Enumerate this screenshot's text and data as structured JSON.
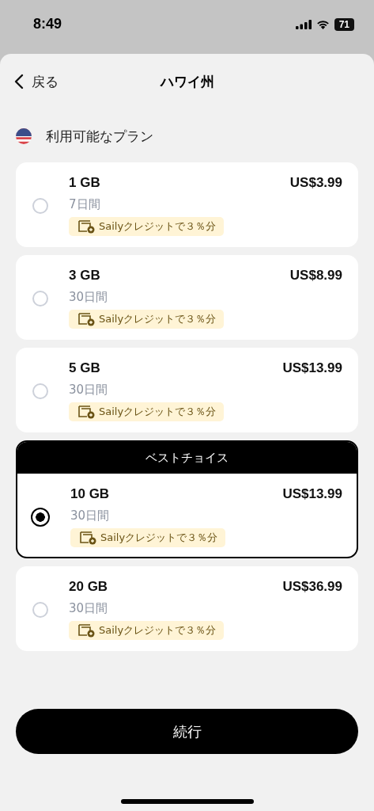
{
  "status_bar": {
    "time": "8:49",
    "battery": "71"
  },
  "header": {
    "back": "戻る",
    "title": "ハワイ州"
  },
  "section": {
    "title": "利用可能なプラン"
  },
  "plans": [
    {
      "size": "1 GB",
      "duration": "7日間",
      "price": "US$3.99",
      "credit": "Sailyクレジットで３％分",
      "selected": false
    },
    {
      "size": "3 GB",
      "duration": "30日間",
      "price": "US$8.99",
      "credit": "Sailyクレジットで３％分",
      "selected": false
    },
    {
      "size": "5 GB",
      "duration": "30日間",
      "price": "US$13.99",
      "credit": "Sailyクレジットで３％分",
      "selected": false
    },
    {
      "size": "10 GB",
      "duration": "30日間",
      "price": "US$13.99",
      "credit": "Sailyクレジットで３％分",
      "selected": true,
      "highlight": "ベストチョイス"
    },
    {
      "size": "20 GB",
      "duration": "30日間",
      "price": "US$36.99",
      "credit": "Sailyクレジットで３％分",
      "selected": false
    }
  ],
  "continue_button": "続行"
}
